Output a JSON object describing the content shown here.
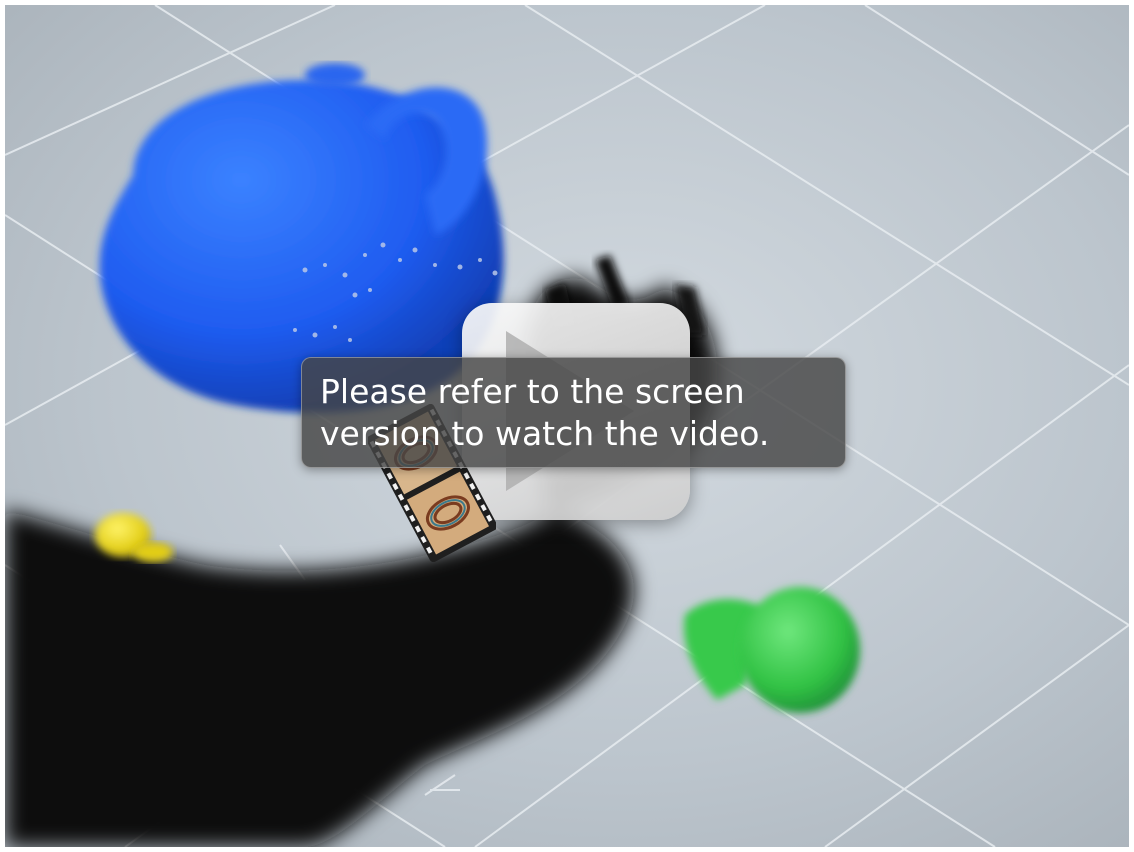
{
  "overlay": {
    "message_line_1": "Please refer to the screen",
    "message_line_2": "version to watch the video."
  },
  "icons": {
    "play": "play-icon",
    "film": "film-strip-icon"
  },
  "colors": {
    "background_scene": "#b8c2cb",
    "teapot": "#1f5ff0",
    "duck": "#e6d21c",
    "green_objects": "#35c64a",
    "arm": "#0d0d0d",
    "overlay": "#464646"
  }
}
